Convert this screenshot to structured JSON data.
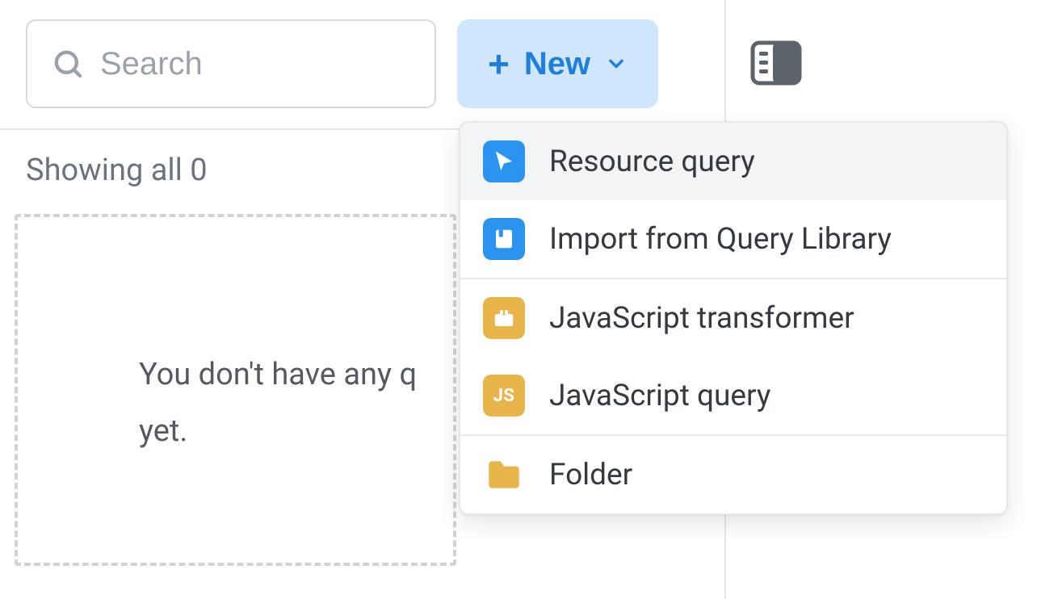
{
  "toolbar": {
    "search_placeholder": "Search",
    "new_label": "New"
  },
  "status": {
    "showing_text": "Showing all 0"
  },
  "empty": {
    "line1": "You don't have any q",
    "line2": "yet."
  },
  "menu": {
    "items": [
      {
        "label": "Resource query",
        "icon": "cursor",
        "color": "blue"
      },
      {
        "label": "Import from Query Library",
        "icon": "book",
        "color": "blue"
      },
      {
        "label": "JavaScript transformer",
        "icon": "briefcase",
        "color": "amber"
      },
      {
        "label": "JavaScript query",
        "icon": "js",
        "color": "amber"
      },
      {
        "label": "Folder",
        "icon": "folder",
        "color": "amber"
      }
    ]
  }
}
